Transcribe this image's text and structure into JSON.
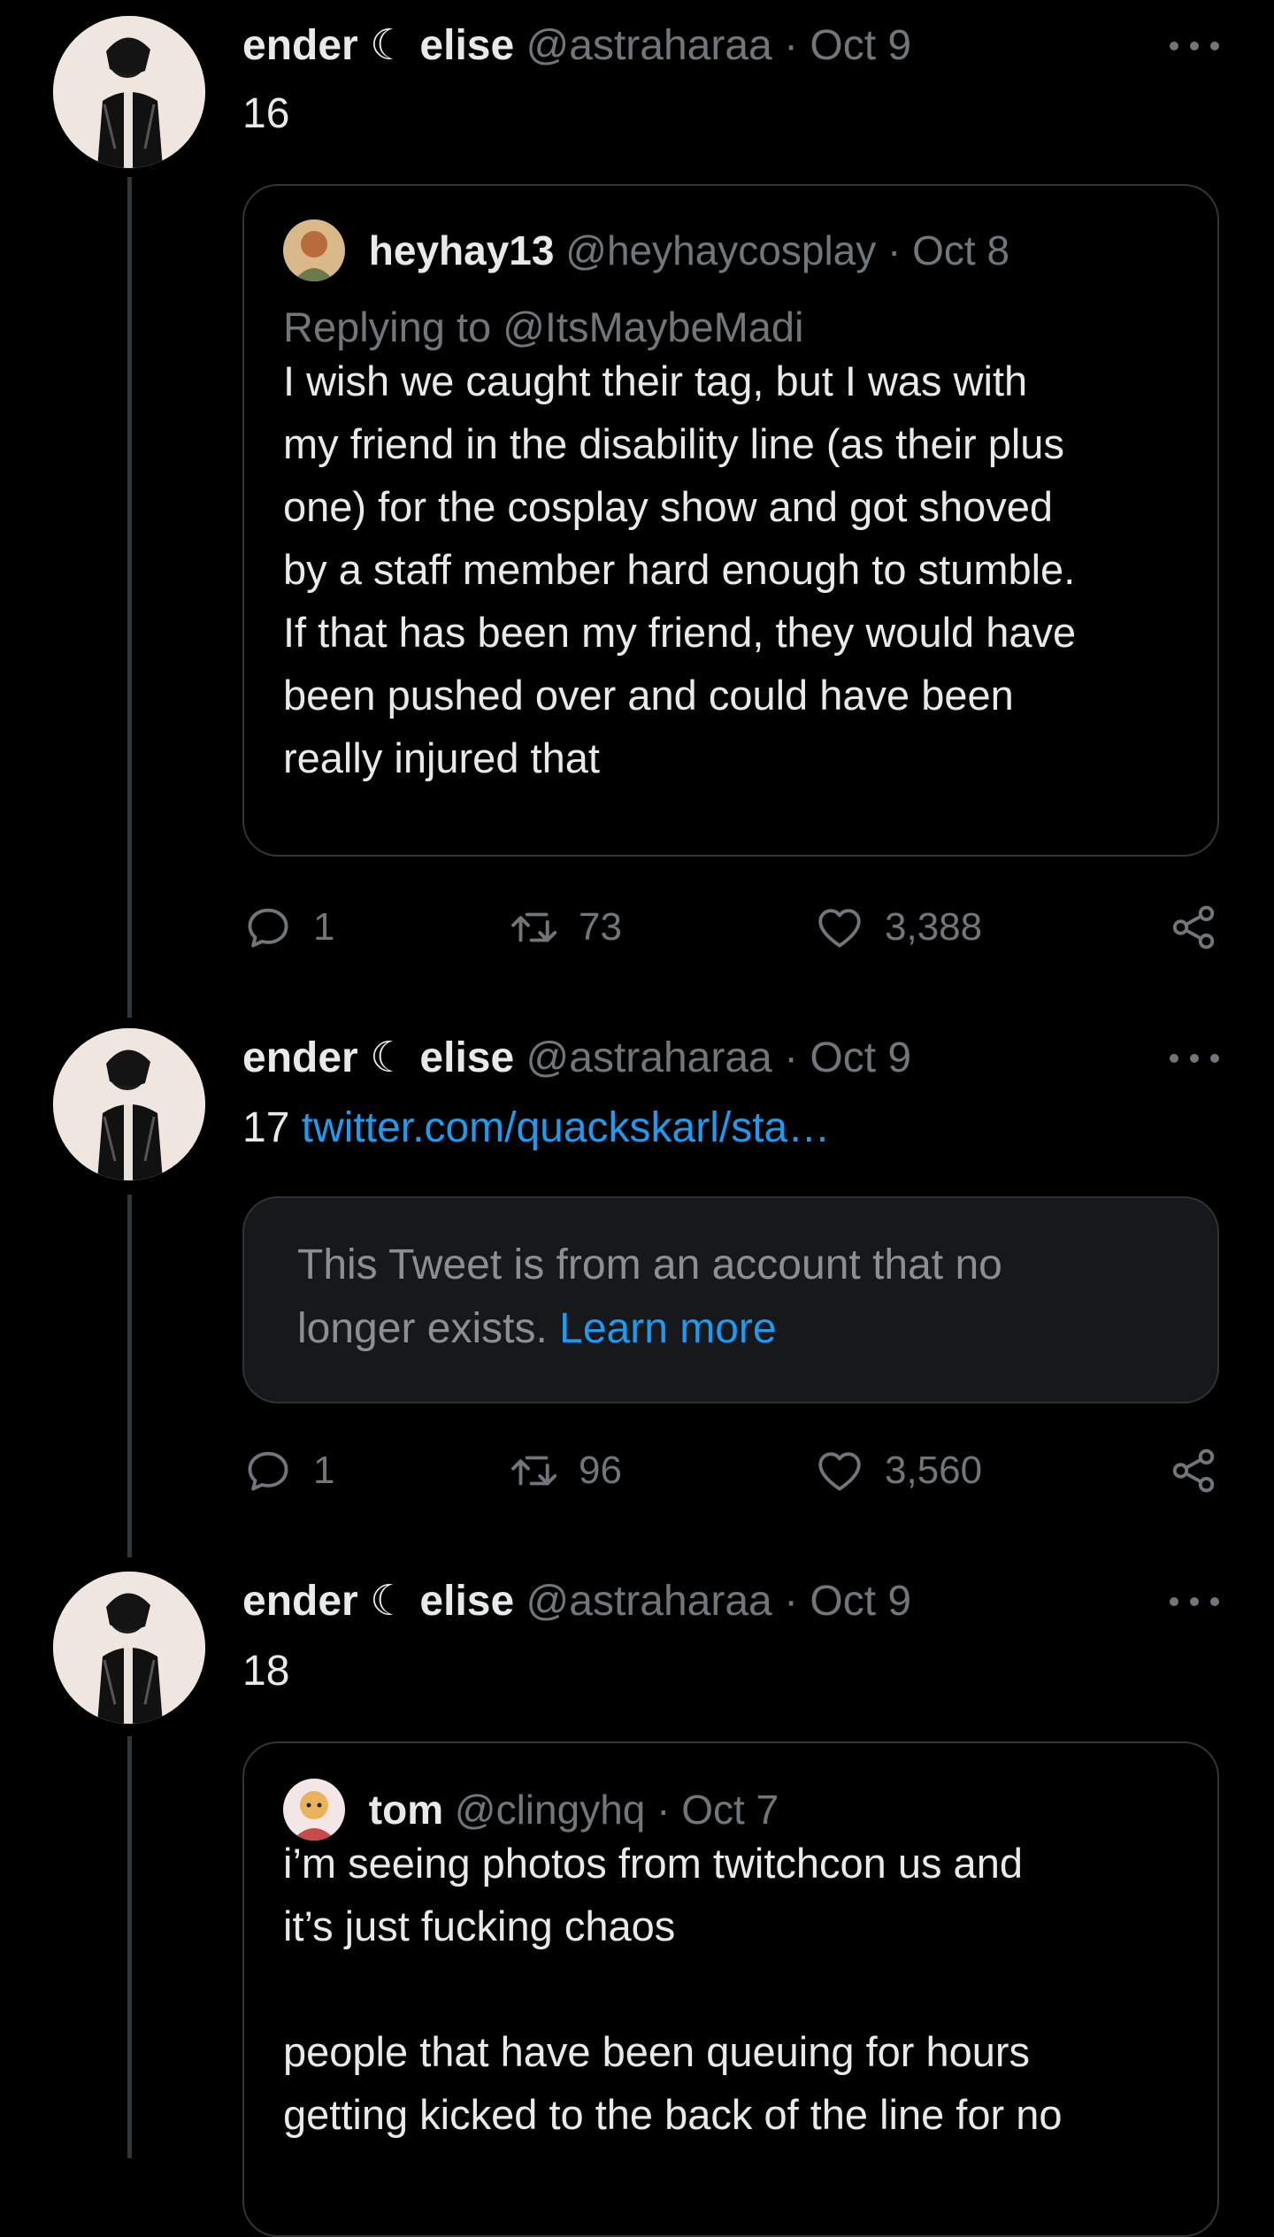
{
  "tweets": [
    {
      "name": "ender ☾ elise",
      "handle": "@astraharaa",
      "separator": "·",
      "date": "Oct 9",
      "text": "16",
      "quote": {
        "name": "heyhay13",
        "handle": "@heyhaycosplay",
        "separator": "·",
        "date": "Oct 8",
        "replying_to": "Replying to @ItsMaybeMadi",
        "lines": [
          "I wish we caught their tag, but I was with",
          "my friend in the disability line (as their plus",
          "one) for the cosplay show and got shoved",
          "by a staff member hard enough to stumble.",
          "If that has been my friend, they would have",
          "been pushed over and could have been",
          "really injured that"
        ]
      },
      "replies": "1",
      "retweets": "73",
      "likes": "3,388"
    },
    {
      "name": "ender ☾ elise",
      "handle": "@astraharaa",
      "separator": "·",
      "date": "Oct 9",
      "text": "17",
      "link": "twitter.com/quackskarl/sta…",
      "unavailable": {
        "line1": "This Tweet is from an account that no",
        "line2": "longer exists.",
        "learn_more": "Learn more"
      },
      "replies": "1",
      "retweets": "96",
      "likes": "3,560"
    },
    {
      "name": "ender ☾ elise",
      "handle": "@astraharaa",
      "separator": "·",
      "date": "Oct 9",
      "text": "18",
      "quote": {
        "name": "tom",
        "handle": "@clingyhq",
        "separator": "·",
        "date": "Oct 7",
        "lines": [
          "i’m seeing photos from twitchcon us and",
          "it’s just fucking chaos",
          "",
          "people that have been queuing for hours",
          "getting kicked to the back of the line for no"
        ]
      }
    }
  ],
  "icons": {
    "reply": "reply-icon",
    "retweet": "retweet-icon",
    "like": "like-icon",
    "share": "share-icon",
    "more": "more-icon"
  },
  "colors": {
    "background": "#000000",
    "link": "#1d9bf0",
    "muted": "#71767b",
    "border": "#333639"
  }
}
